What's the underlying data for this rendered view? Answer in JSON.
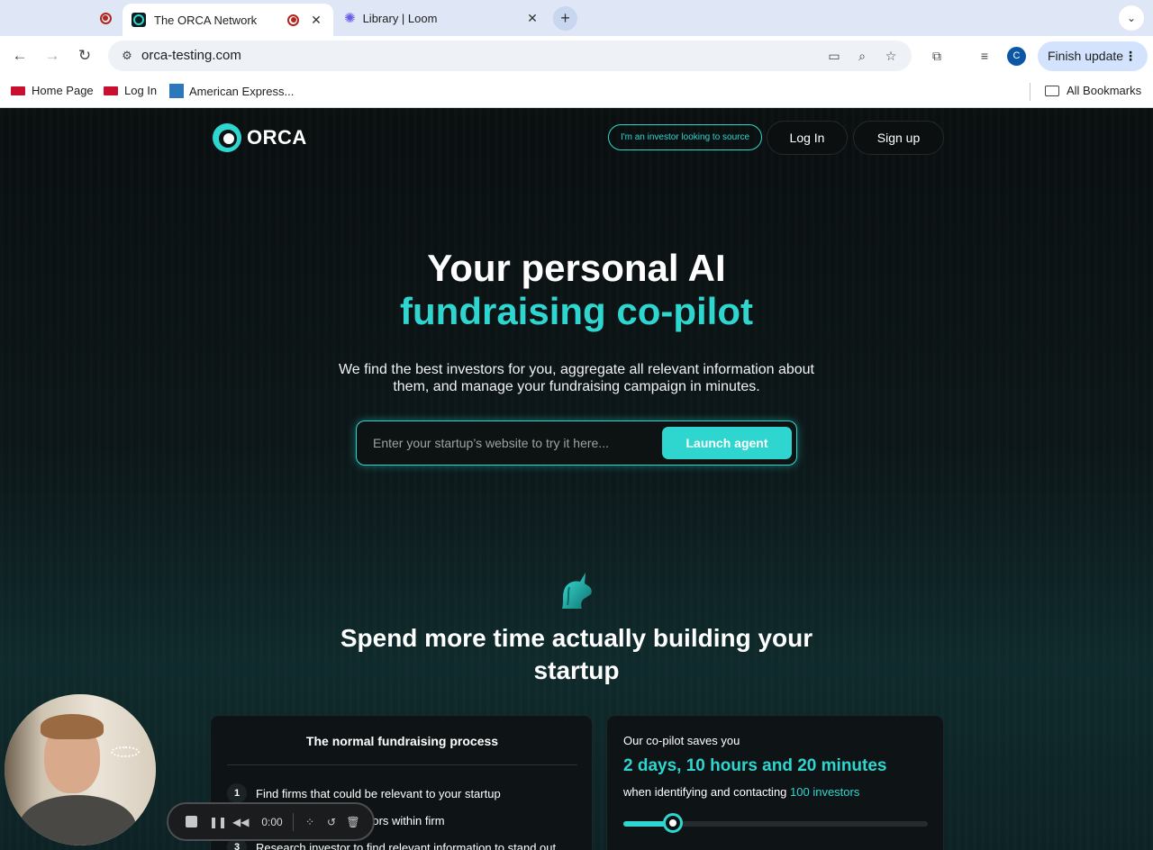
{
  "browser": {
    "tabs": [
      {
        "title": "The ORCA Network",
        "active": true
      },
      {
        "title": "Library | Loom",
        "active": false
      }
    ],
    "url": "orca-testing.com",
    "profile_initial": "C",
    "finish_update_label": "Finish update",
    "bookmarks": [
      "Home Page",
      "Log In",
      "American Express..."
    ],
    "all_bookmarks_label": "All Bookmarks"
  },
  "site": {
    "logo_text": "ORCA",
    "nav": {
      "investor_link": "I'm an investor looking to source",
      "login": "Log In",
      "signup": "Sign up"
    },
    "hero": {
      "title_line1": "Your personal AI",
      "title_line2": "fundraising co-pilot",
      "subtitle": "We find the best investors for you, aggregate all relevant information about them, and manage your fundraising campaign in minutes.",
      "input_placeholder": "Enter your startup’s website to try it here...",
      "cta": "Launch agent"
    },
    "section_title": "Spend more time actually building your startup",
    "normal_process": {
      "title": "The normal fundraising process",
      "steps": [
        {
          "num": "1",
          "text": "Find firms that could be relevant to your startup"
        },
        {
          "num": "2",
          "text": "Identify relevant investors within firm"
        },
        {
          "num": "3",
          "text": "Research investor to find relevant information to stand out"
        }
      ]
    },
    "copilot": {
      "label": "Our co-pilot saves you",
      "time_saved": "2 days, 10 hours and 20 minutes",
      "detail_prefix": "when identifying and contacting",
      "investor_count": "100 investors",
      "slider_fraction": 0.13
    }
  },
  "loom": {
    "timer": "0:00"
  },
  "colors": {
    "accent": "#2fd6cf",
    "page_background": "#0b1314",
    "tab_strip": "#dfe6f5"
  }
}
